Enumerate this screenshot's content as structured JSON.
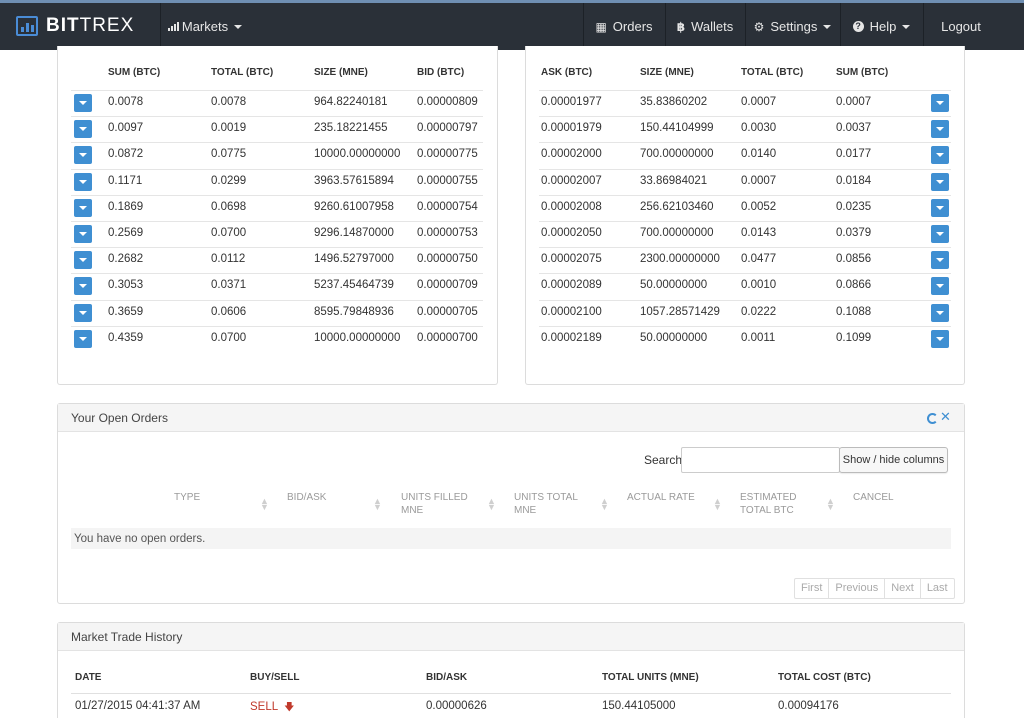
{
  "nav": {
    "brand_bold": "BIT",
    "brand_light": "TREX",
    "markets": "Markets",
    "orders": "Orders",
    "wallets": "Wallets",
    "settings": "Settings",
    "help": "Help",
    "logout": "Logout"
  },
  "bids": {
    "headers": [
      "SUM (BTC)",
      "TOTAL (BTC)",
      "SIZE (MNE)",
      "BID (BTC)"
    ],
    "rows": [
      [
        "0.0078",
        "0.0078",
        "964.82240181",
        "0.00000809"
      ],
      [
        "0.0097",
        "0.0019",
        "235.18221455",
        "0.00000797"
      ],
      [
        "0.0872",
        "0.0775",
        "10000.00000000",
        "0.00000775"
      ],
      [
        "0.1171",
        "0.0299",
        "3963.57615894",
        "0.00000755"
      ],
      [
        "0.1869",
        "0.0698",
        "9260.61007958",
        "0.00000754"
      ],
      [
        "0.2569",
        "0.0700",
        "9296.14870000",
        "0.00000753"
      ],
      [
        "0.2682",
        "0.0112",
        "1496.52797000",
        "0.00000750"
      ],
      [
        "0.3053",
        "0.0371",
        "5237.45464739",
        "0.00000709"
      ],
      [
        "0.3659",
        "0.0606",
        "8595.79848936",
        "0.00000705"
      ],
      [
        "0.4359",
        "0.0700",
        "10000.00000000",
        "0.00000700"
      ]
    ]
  },
  "asks": {
    "headers": [
      "ASK (BTC)",
      "SIZE (MNE)",
      "TOTAL (BTC)",
      "SUM (BTC)"
    ],
    "rows": [
      [
        "0.00001977",
        "35.83860202",
        "0.0007",
        "0.0007"
      ],
      [
        "0.00001979",
        "150.44104999",
        "0.0030",
        "0.0037"
      ],
      [
        "0.00002000",
        "700.00000000",
        "0.0140",
        "0.0177"
      ],
      [
        "0.00002007",
        "33.86984021",
        "0.0007",
        "0.0184"
      ],
      [
        "0.00002008",
        "256.62103460",
        "0.0052",
        "0.0235"
      ],
      [
        "0.00002050",
        "700.00000000",
        "0.0143",
        "0.0379"
      ],
      [
        "0.00002075",
        "2300.00000000",
        "0.0477",
        "0.0856"
      ],
      [
        "0.00002089",
        "50.00000000",
        "0.0010",
        "0.0866"
      ],
      [
        "0.00002100",
        "1057.28571429",
        "0.0222",
        "0.1088"
      ],
      [
        "0.00002189",
        "50.00000000",
        "0.0011",
        "0.1099"
      ]
    ]
  },
  "open_orders": {
    "title": "Your Open Orders",
    "search_label": "Search:",
    "search_value": "",
    "columns_button": "Show / hide columns",
    "columns": [
      [
        "TYPE",
        ""
      ],
      [
        "BID/ASK",
        ""
      ],
      [
        "UNITS FILLED",
        "MNE"
      ],
      [
        "UNITS TOTAL",
        "MNE"
      ],
      [
        "ACTUAL RATE",
        ""
      ],
      [
        "ESTIMATED",
        "TOTAL BTC"
      ],
      [
        "CANCEL",
        ""
      ]
    ],
    "empty_text": "You have no open orders.",
    "pager": [
      "First",
      "Previous",
      "Next",
      "Last"
    ]
  },
  "trade_history": {
    "title": "Market Trade History",
    "headers": [
      "DATE",
      "BUY/SELL",
      "BID/ASK",
      "TOTAL UNITS (MNE)",
      "TOTAL COST (BTC)"
    ],
    "rows": [
      [
        "01/27/2015 04:41:37 AM",
        "SELL",
        "0.00000626",
        "150.44105000",
        "0.00094176"
      ]
    ]
  }
}
